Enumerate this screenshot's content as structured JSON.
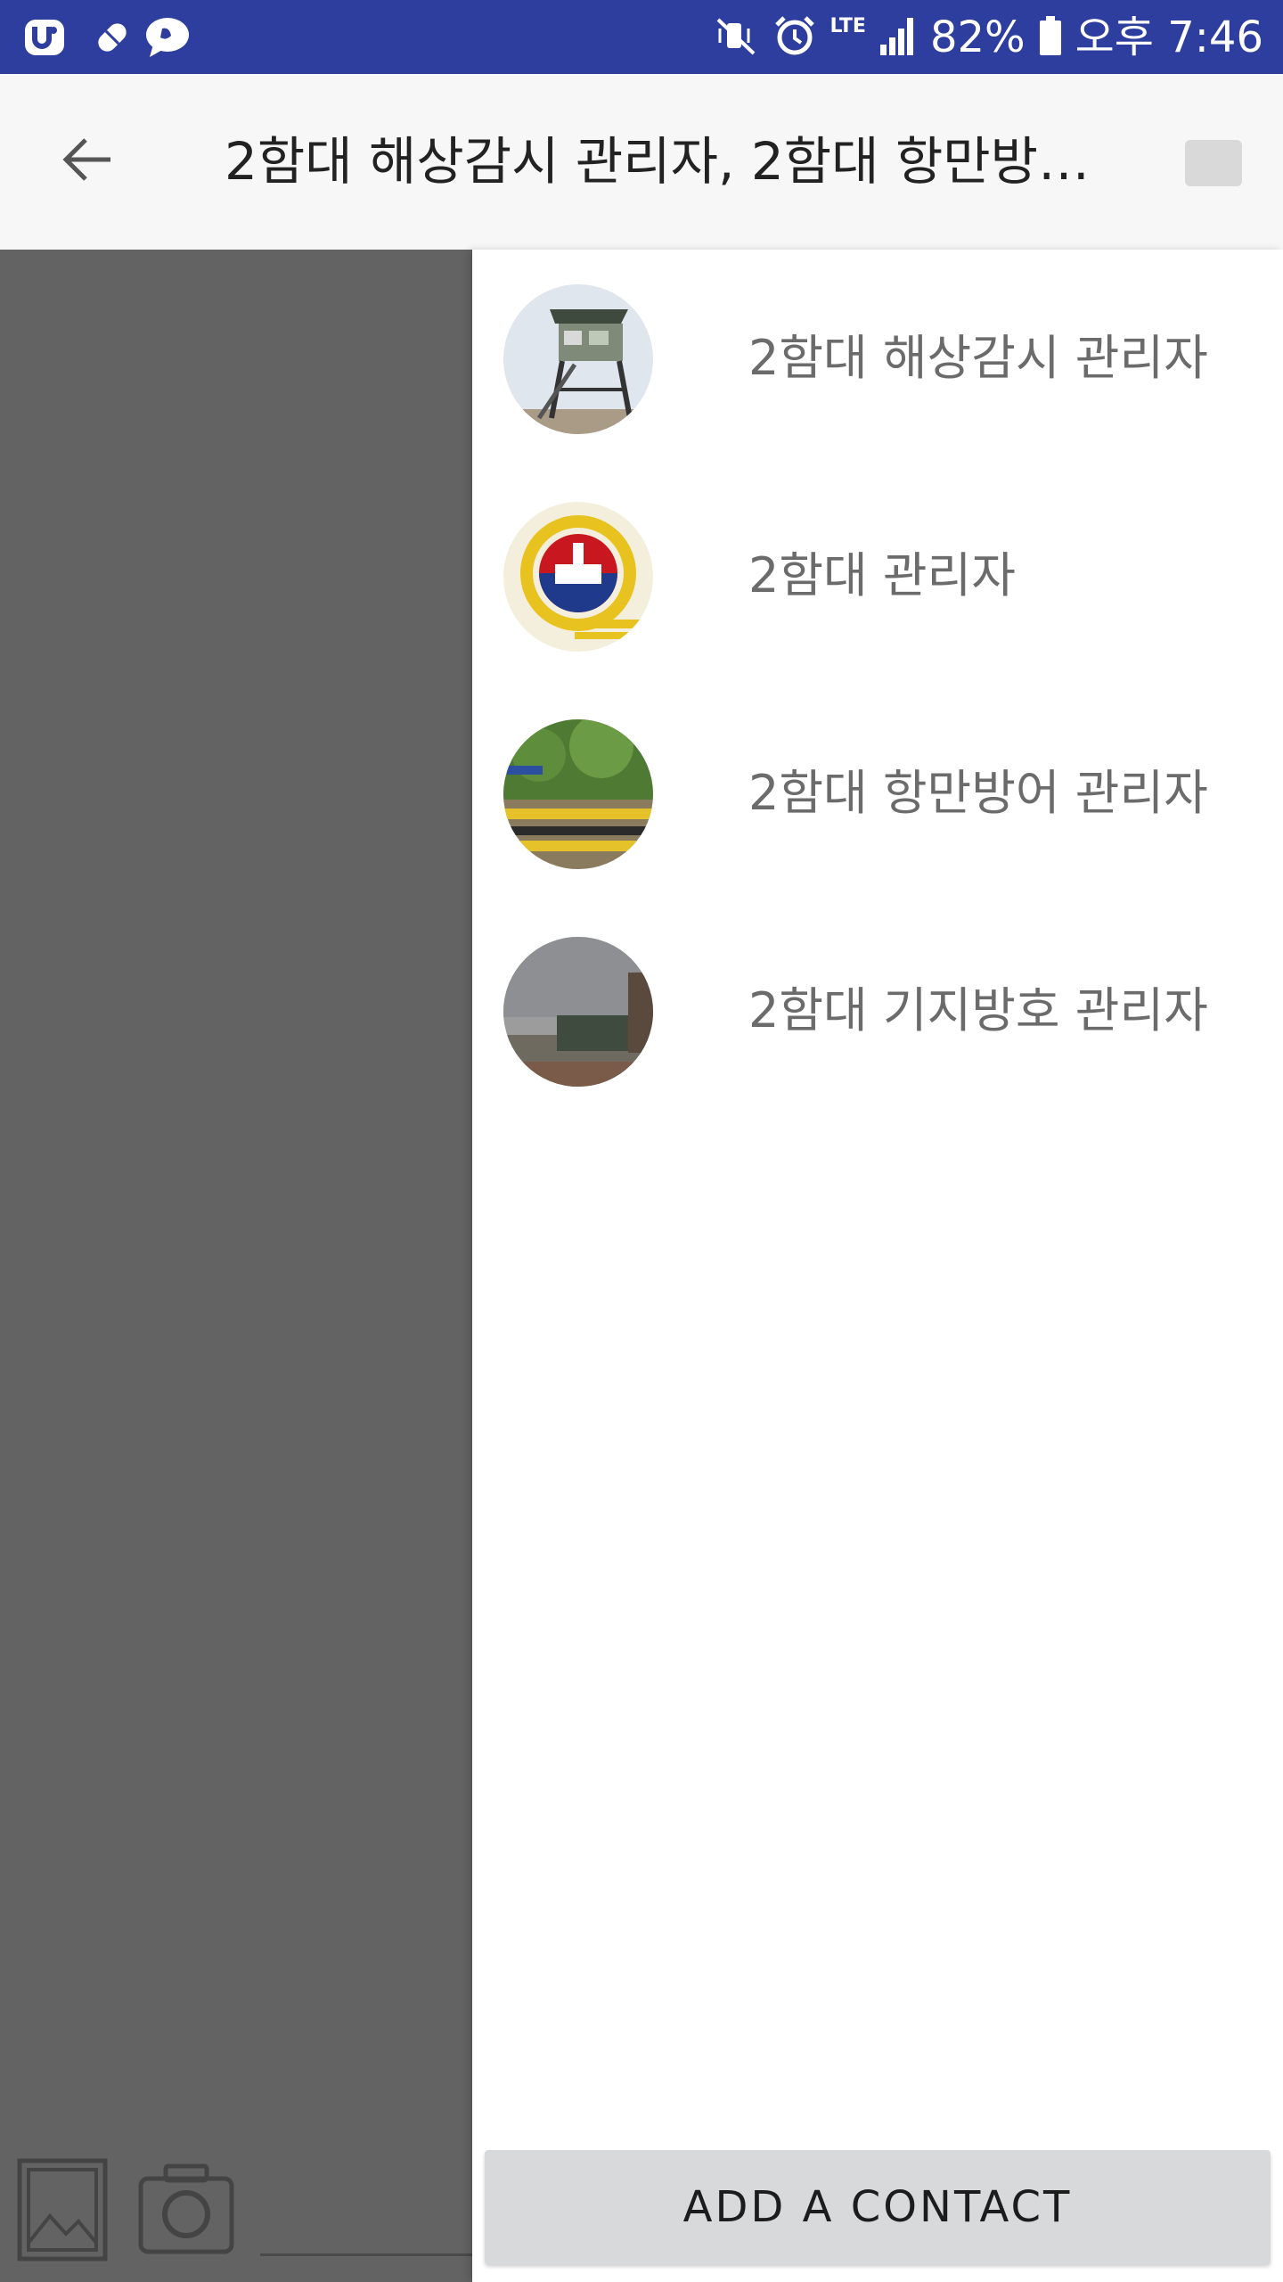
{
  "status_bar": {
    "battery_percent": "82%",
    "time": "오후 7:46",
    "network": "LTE",
    "left_icons": [
      "u-plus-app-icon",
      "pill-icon",
      "chat-bubble-icon"
    ],
    "right_icons": [
      "mute-vibrate-icon",
      "alarm-icon",
      "lte-icon",
      "signal-icon",
      "battery-icon"
    ],
    "color": "#2d3e9e"
  },
  "app_bar": {
    "title": "2함대 해상감시 관리자, 2함대 항만방…",
    "back_icon": "arrow-left-icon"
  },
  "members": [
    {
      "name": "2함대 해상감시 관리자",
      "avatar": "watchtower-photo"
    },
    {
      "name": "2함대 관리자",
      "avatar": "fleet-emblem"
    },
    {
      "name": "2함대 항만방어 관리자",
      "avatar": "harbor-barrier-photo"
    },
    {
      "name": "2함대 기지방호 관리자",
      "avatar": "base-guardpost-photo"
    }
  ],
  "add_contact_label": "ADD A CONTACT",
  "bottom_bar": {
    "icons": [
      "gallery-icon",
      "camera-icon"
    ]
  }
}
